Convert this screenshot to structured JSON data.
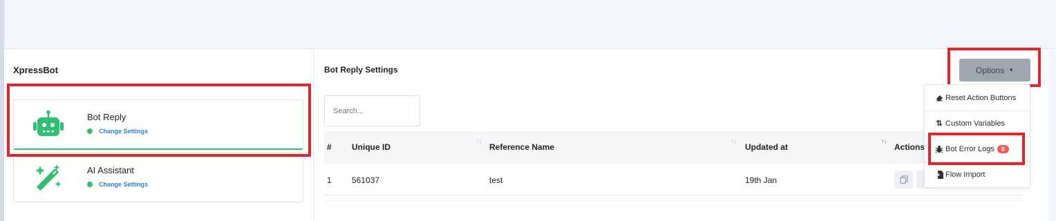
{
  "app": {
    "title": "XpressBot"
  },
  "bots": [
    {
      "name": "Bot Reply",
      "link": "Change Settings",
      "icon": "robot-icon"
    },
    {
      "name": "AI Assistant",
      "link": "Change Settings",
      "icon": "magic-wand-icon"
    }
  ],
  "main": {
    "title": "Bot Reply Settings",
    "search_placeholder": "Search...",
    "columns": [
      "#",
      "Unique ID",
      "Reference Name",
      "Updated at",
      "Actions"
    ],
    "rows": [
      {
        "index": "1",
        "unique_id": "561037",
        "reference_name": "test",
        "updated_at": "19th Jan"
      }
    ]
  },
  "options": {
    "label": "Options",
    "items": [
      {
        "label": "Reset Action Buttons",
        "icon": "eraser-icon"
      },
      {
        "label": "Custom Variables",
        "icon": "sort-arrows-icon"
      },
      {
        "label": "Bot Error Logs",
        "icon": "bug-icon",
        "badge": "0"
      },
      {
        "label": "Flow Import",
        "icon": "file-import-icon"
      }
    ]
  },
  "colors": {
    "accent_green": "#2fbf71",
    "link_blue": "#2c7fd1",
    "highlight_red": "#e0262b",
    "badge_red": "#ef5a5a",
    "options_gray": "#a0a7b2"
  }
}
